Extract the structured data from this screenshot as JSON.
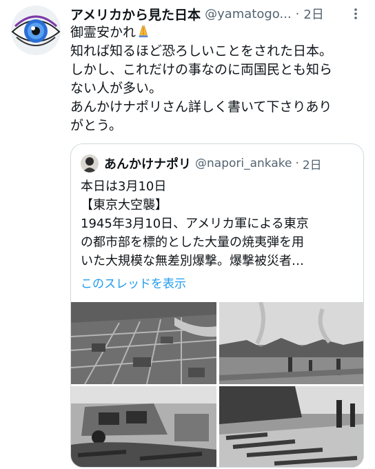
{
  "tweet": {
    "display_name": "アメリカから見た日本",
    "handle": "@yamatogo...",
    "separator": "·",
    "time": "2日",
    "more_icon": "more-vertical-icon",
    "lines": [
      "御霊安かれ",
      "知れば知るほど恐ろしいことをされた日本。",
      "しかし、これだけの事なのに両国民とも知ら",
      "ない人が多い。",
      "あんかけナポリさん詳しく書いて下さりあり",
      "がとう。"
    ],
    "emoji": "folded-hands-emoji"
  },
  "quote": {
    "display_name": "あんかけナポリ",
    "handle": "@napori_ankake",
    "separator": "·",
    "time": "2日",
    "lines": [
      "本日は3月10日",
      "【東京大空襲】",
      "1945年3月10日、アメリカ軍による東京",
      "の都市部を標的とした大量の焼夷弾を用",
      "いた大規模な無差別爆撃。爆撃被災者…"
    ],
    "show_thread": "このスレッドを表示"
  },
  "colors": {
    "text": "#0f1419",
    "secondary": "#536471",
    "link": "#1d9bf0",
    "border": "#cfd9de"
  }
}
